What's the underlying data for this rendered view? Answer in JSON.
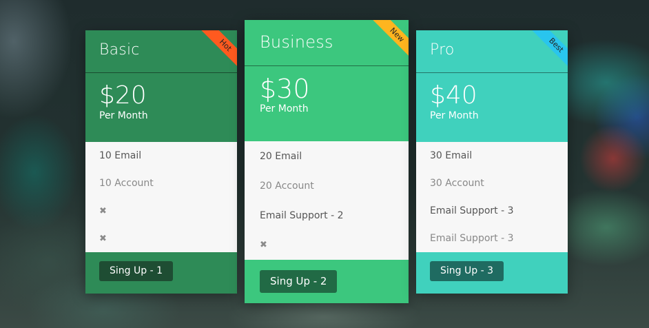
{
  "colors": {
    "basic": "#2e8b57",
    "business": "#3cc77e",
    "pro": "#40d1bd",
    "ribbon_hot": "#ff5a1f",
    "ribbon_new": "#ffb51f",
    "ribbon_best": "#29c5ee"
  },
  "plans": [
    {
      "name": "Basic",
      "ribbon": "Hot",
      "price": "$20",
      "period": "Per Month",
      "features": [
        "10 Email",
        "10 Account",
        "✖",
        "✖"
      ],
      "button": "Sing Up - 1"
    },
    {
      "name": "Business",
      "ribbon": "New",
      "price": "$30",
      "period": "Per Month",
      "features": [
        "20 Email",
        "20 Account",
        "Email Support - 2",
        "✖"
      ],
      "button": "Sing Up - 2"
    },
    {
      "name": "Pro",
      "ribbon": "Best",
      "price": "$40",
      "period": "Per Month",
      "features": [
        "30 Email",
        "30 Account",
        "Email Support - 3",
        "Email Support - 3"
      ],
      "button": "Sing Up - 3"
    }
  ]
}
